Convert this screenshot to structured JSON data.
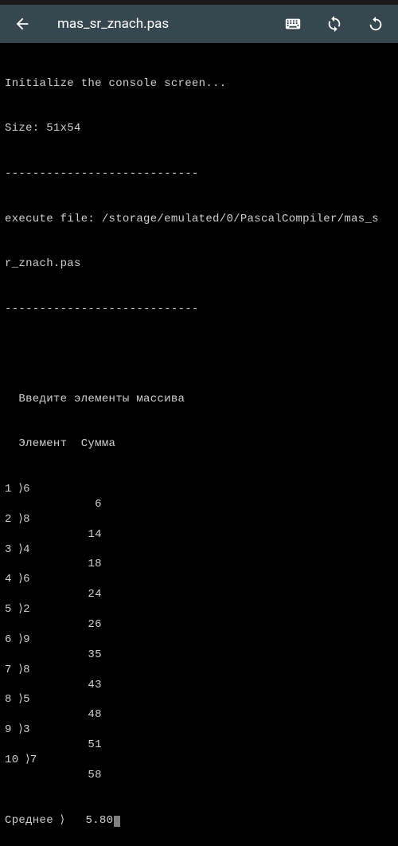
{
  "toolbar": {
    "title": "mas_sr_znach.pas"
  },
  "console": {
    "init_line": "Initialize the console screen...",
    "size_line": "Size: 51x54",
    "dashes": "----------------------------",
    "exec_line1": "execute file: /storage/emulated/0/PascalCompiler/mas_s",
    "exec_line2": "r_znach.pas",
    "header_prompt": "  Введите элементы массива",
    "header_cols": "  Элемент  Сумма",
    "entries": [
      {
        "idx": "1",
        "val": "6",
        "sum": "6"
      },
      {
        "idx": "2",
        "val": "8",
        "sum": "14"
      },
      {
        "idx": "3",
        "val": "4",
        "sum": "18"
      },
      {
        "idx": "4",
        "val": "6",
        "sum": "24"
      },
      {
        "idx": "5",
        "val": "2",
        "sum": "26"
      },
      {
        "idx": "6",
        "val": "9",
        "sum": "35"
      },
      {
        "idx": "7",
        "val": "8",
        "sum": "43"
      },
      {
        "idx": "8",
        "val": "5",
        "sum": "48"
      },
      {
        "idx": "9",
        "val": "3",
        "sum": "51"
      },
      {
        "idx": "10",
        "val": "7",
        "sum": "58"
      }
    ],
    "avg_label": "Среднее ⟩",
    "avg_value": "5.80"
  }
}
